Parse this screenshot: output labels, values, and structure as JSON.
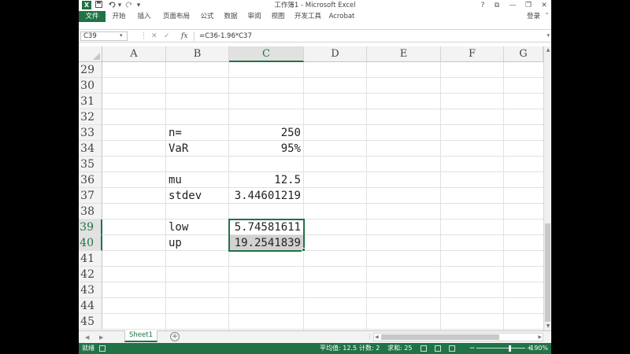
{
  "window": {
    "title": "工作簿1 - Microsoft Excel",
    "app_icon": "X",
    "controls": [
      "?",
      "⧉",
      "—",
      "❐",
      "✕"
    ]
  },
  "quick_access": {
    "save_icon": "save-icon",
    "undo_icon": "undo-icon",
    "redo_icon": "redo-icon",
    "customize_icon": "customize-icon"
  },
  "ribbon": {
    "tabs": [
      "文件",
      "开始",
      "插入",
      "页面布局",
      "公式",
      "数据",
      "审阅",
      "视图",
      "开发工具",
      "Acrobat"
    ],
    "active_tab": "文件",
    "login": "登录"
  },
  "formula_bar": {
    "name_box": "C39",
    "fx": "fx",
    "formula": "=C36-1.96*C37"
  },
  "grid": {
    "columns": [
      "A",
      "B",
      "C",
      "D",
      "E",
      "F",
      "G"
    ],
    "selected_column": "C",
    "rows": [
      "29",
      "30",
      "31",
      "32",
      "33",
      "34",
      "35",
      "36",
      "37",
      "38",
      "39",
      "40",
      "41",
      "42",
      "43",
      "44",
      "45"
    ],
    "selected_rows": [
      "39",
      "40"
    ],
    "cells": {
      "B33": "n=",
      "C33": "250",
      "B34": "VaR",
      "C34": "95%",
      "B36": "mu",
      "C36": "12.5",
      "B37": "stdev",
      "C37": "3.44601219",
      "B39": "low",
      "C39": "5.74581611",
      "B40": "up",
      "C40": "19.2541839"
    }
  },
  "sheets": {
    "tabs": [
      "Sheet1"
    ],
    "active": "Sheet1",
    "add_label": "+"
  },
  "status": {
    "ready": "就绪",
    "average": "平均值: 12.5",
    "count": "计数: 2",
    "sum": "求和: 25",
    "zoom": "190%"
  },
  "colors": {
    "accent": "#217346",
    "selected_cell_fill": "#d2d2d2",
    "header_fill": "#f3f3f3"
  }
}
